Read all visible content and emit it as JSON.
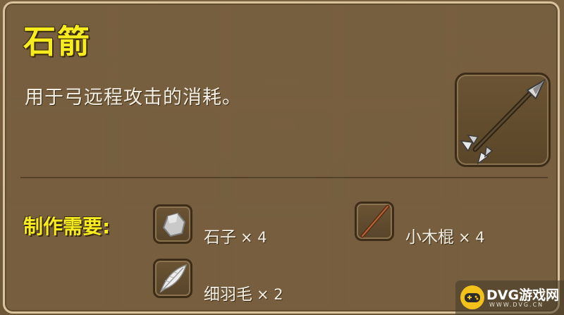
{
  "item": {
    "name": "石箭",
    "description": "用于弓远程攻击的消耗。",
    "icon": "arrow-icon"
  },
  "recipe": {
    "label": "制作需要:",
    "materials": [
      {
        "name": "石子",
        "count": "× 4",
        "icon": "stone-icon"
      },
      {
        "name": "小木棍",
        "count": "× 4",
        "icon": "stick-icon"
      },
      {
        "name": "细羽毛",
        "count": "× 2",
        "icon": "feather-icon"
      }
    ]
  },
  "watermark": {
    "main": "DVG游戏网",
    "sub": "WWW.DVG.CN"
  },
  "colors": {
    "title": "#f7ec1d",
    "panel": "#76603f",
    "border": "#d8c39c"
  }
}
